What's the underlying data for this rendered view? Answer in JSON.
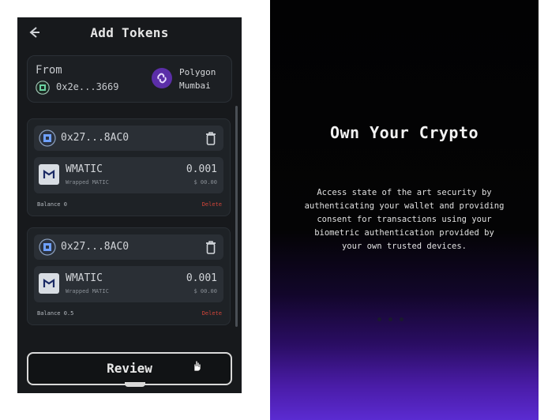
{
  "left": {
    "title": "Add Tokens",
    "from": {
      "label": "From",
      "address": "0x2e...3669",
      "network": {
        "line1": "Polygon",
        "line2": "Mumbai"
      }
    },
    "tokens": [
      {
        "address": "0x27...8AC0",
        "symbol": "WMATIC",
        "name": "Wrapped MATIC",
        "amount": "0.001",
        "fiat": "$ 00.00",
        "balance": "Balance 0",
        "delete": "Delete"
      },
      {
        "address": "0x27...8AC0",
        "symbol": "WMATIC",
        "name": "Wrapped MATIC",
        "amount": "0.001",
        "fiat": "$ 00.00",
        "balance": "Balance 0.5",
        "delete": "Delete"
      }
    ],
    "review_label": "Review"
  },
  "right": {
    "title": "Own Your Crypto",
    "description_lines": [
      "Access state of the art security by",
      "authenticating your wallet and providing",
      "consent for transactions using your",
      "biometric authentication provided by",
      "your own trusted devices."
    ]
  },
  "icons": {
    "back": "arrow-left-icon",
    "wallet": "wallet-avatar-icon",
    "network": "polygon-link-icon",
    "trash": "trash-icon",
    "token_logo": "matic-logo-icon",
    "cursor": "hand-cursor-icon"
  },
  "colors": {
    "background": "#17191c",
    "card": "#1e2226",
    "row": "#2a2f35",
    "accent_purple": "#5b2bd1",
    "delete_red": "#d0453a"
  }
}
